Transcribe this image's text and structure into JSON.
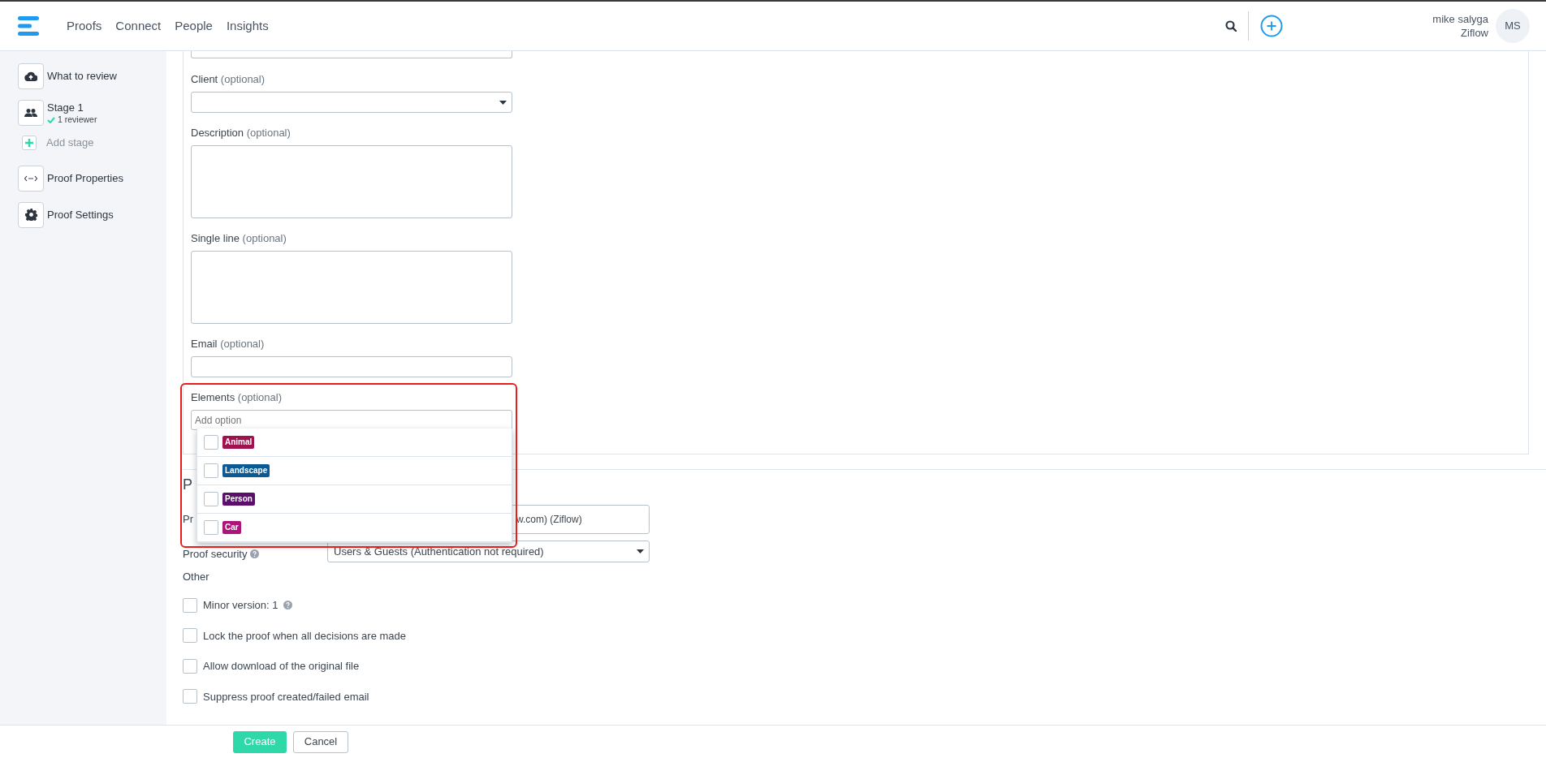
{
  "nav": {
    "links": [
      {
        "label": "Proofs"
      },
      {
        "label": "Connect"
      },
      {
        "label": "People"
      },
      {
        "label": "Insights"
      }
    ]
  },
  "user": {
    "name": "mike salyga",
    "org": "Ziflow",
    "initials": "MS"
  },
  "sidebar": {
    "items": [
      {
        "kind": "step",
        "label": "What to review"
      },
      {
        "kind": "step",
        "label": "Stage 1",
        "status": "1 reviewer"
      },
      {
        "kind": "add",
        "label": "Add stage"
      },
      {
        "kind": "step",
        "label": "Proof Properties"
      },
      {
        "kind": "step",
        "label": "Proof Settings"
      }
    ]
  },
  "form": {
    "fields": [
      {
        "kind": "select",
        "label": "Client",
        "note": "(optional)"
      },
      {
        "kind": "textarea",
        "label": "Description",
        "note": "(optional)"
      },
      {
        "kind": "textarea",
        "label": "Single line",
        "note": "(optional)"
      },
      {
        "kind": "input",
        "label": "Email",
        "note": "(optional)"
      }
    ]
  },
  "elements_dropdown": {
    "label": "Elements",
    "note": "(optional)",
    "placeholder": "Add option",
    "options": [
      {
        "label": "Animal",
        "color": "#a0114f",
        "checked": false
      },
      {
        "label": "Landscape",
        "color": "#0b5a94",
        "checked": false
      },
      {
        "label": "Person",
        "color": "#5c0e6b",
        "checked": false
      },
      {
        "label": "Car",
        "color": "#ab1479",
        "checked": false
      }
    ]
  },
  "properties": {
    "heading": "P",
    "owner_label": "Pr",
    "owner_value": "w.com) (Ziflow)",
    "security_label": "Proof security",
    "security_help": true,
    "security_value": "Users & Guests (Authentication not required)",
    "other_heading": "Other",
    "options": [
      {
        "label": "Minor version: 1",
        "help": true,
        "checked": false
      },
      {
        "label": "Lock the proof when all decisions are made",
        "help": false,
        "checked": false
      },
      {
        "label": "Allow download of the original file",
        "help": false,
        "checked": false
      },
      {
        "label": "Suppress proof created/failed email",
        "help": false,
        "checked": false
      }
    ]
  },
  "footer": {
    "buttons": [
      {
        "kind": "primary",
        "label": "Create"
      },
      {
        "kind": "secondary",
        "label": "Cancel"
      }
    ]
  }
}
